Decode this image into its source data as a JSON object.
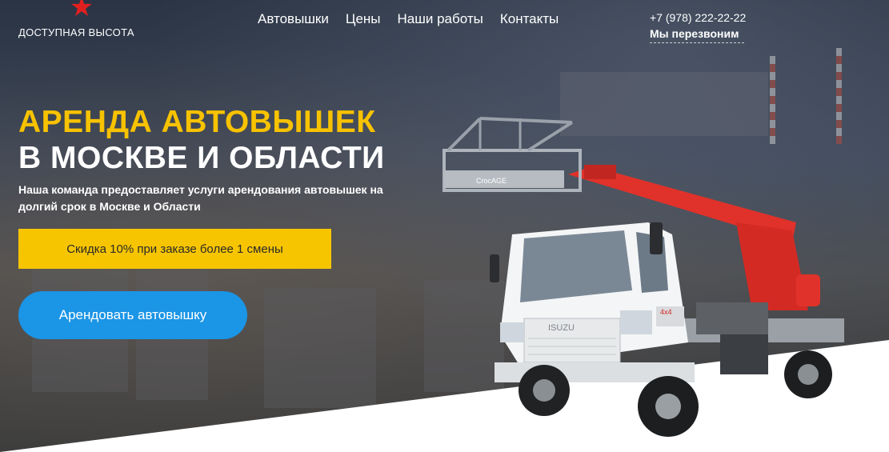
{
  "logo": {
    "name": "ДОСТУПНАЯ ВЫСОТА",
    "star": "★"
  },
  "nav": {
    "items": [
      {
        "label": "Автовышки"
      },
      {
        "label": "Цены"
      },
      {
        "label": "Наши работы"
      },
      {
        "label": "Контакты"
      }
    ]
  },
  "contact": {
    "phone": "+7 (978) 222-22-22",
    "callback": "Мы перезвоним"
  },
  "hero": {
    "title_line1": "АРЕНДА АВТОВЫШЕК",
    "title_line2": "В МОСКВЕ И ОБЛАСТИ",
    "subtitle": "Наша команда предоставляет услуги арендования автовышек на долгий срок в Москве и Области",
    "discount": "Скидка 10% при заказе более 1 смены",
    "cta": "Арендовать автовышку"
  },
  "truck": {
    "brand": "ISUZU",
    "badge": "4x4",
    "basket_label": "CrocAGE"
  },
  "colors": {
    "accent_yellow": "#f7c500",
    "cta_blue": "#1b95e6",
    "star_red": "#e02020",
    "boom_red": "#e0322a"
  }
}
